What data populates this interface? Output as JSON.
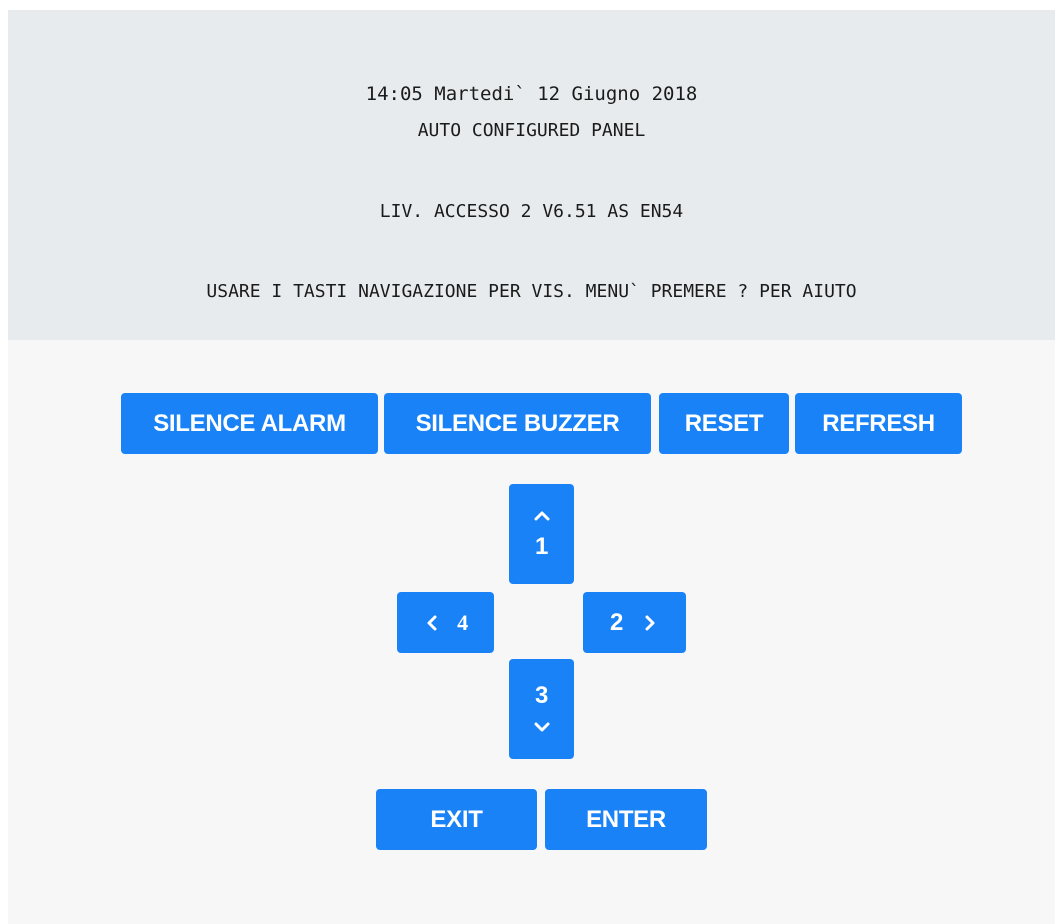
{
  "display": {
    "datetime": "14:05 Martedi` 12 Giugno 2018",
    "panel_name": "AUTO CONFIGURED PANEL",
    "access_info": "LIV. ACCESSO 2 V6.51 AS EN54",
    "instructions": "USARE I TASTI NAVIGAZIONE PER VIS. MENU` PREMERE ? PER AIUTO"
  },
  "controls": {
    "silence_alarm": "SILENCE ALARM",
    "silence_buzzer": "SILENCE BUZZER",
    "reset": "RESET",
    "refresh": "REFRESH"
  },
  "navigation": {
    "up_number": "1",
    "right_number": "2",
    "down_number": "3",
    "left_number": "4",
    "up_icon": "chevron-up-icon",
    "right_icon": "chevron-right-icon",
    "down_icon": "chevron-down-icon",
    "left_icon": "chevron-left-icon"
  },
  "actions": {
    "exit": "EXIT",
    "enter": "ENTER"
  },
  "colors": {
    "button": "#1a82f7",
    "display_background": "#e8ebee",
    "page_background": "#f7f7f7"
  }
}
